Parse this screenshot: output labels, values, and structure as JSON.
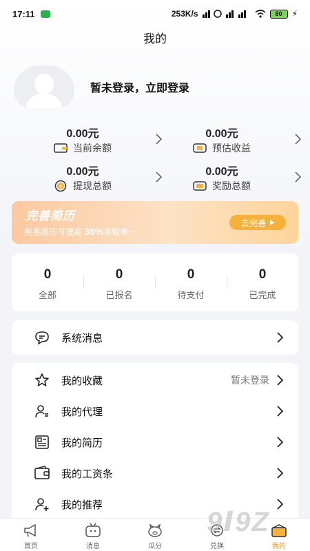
{
  "status_bar": {
    "time": "17:11",
    "speed": "253K/s",
    "battery": "80"
  },
  "header": {
    "title": "我的"
  },
  "profile": {
    "login_text": "暂未登录，立即登录"
  },
  "stats": [
    {
      "value": "0.00元",
      "label": "当前余额",
      "icon": "wallet-icon"
    },
    {
      "value": "0.00元",
      "label": "预估收益",
      "icon": "income-box-icon"
    },
    {
      "value": "0.00元",
      "label": "提现总额",
      "icon": "yen-coin-icon"
    },
    {
      "value": "0.00元",
      "label": "奖励总额",
      "icon": "reward-box-icon"
    }
  ],
  "banner": {
    "title": "完善简历",
    "subtitle_prefix": "完善简历可提高",
    "subtitle_pct": "38%",
    "subtitle_suffix": "录取率~",
    "button_label": "去完善"
  },
  "orders": [
    {
      "count": "0",
      "label": "全部"
    },
    {
      "count": "0",
      "label": "已报名"
    },
    {
      "count": "0",
      "label": "待支付"
    },
    {
      "count": "0",
      "label": "已完成"
    }
  ],
  "system_message": {
    "label": "系统消息"
  },
  "menu": [
    {
      "label": "我的收藏",
      "hint": "暂未登录",
      "icon": "star-icon"
    },
    {
      "label": "我的代理",
      "hint": "",
      "icon": "agent-user-icon"
    },
    {
      "label": "我的简历",
      "hint": "",
      "icon": "resume-icon"
    },
    {
      "label": "我的工资条",
      "hint": "",
      "icon": "payslip-icon"
    },
    {
      "label": "我的推荐",
      "hint": "",
      "icon": "add-user-icon"
    }
  ],
  "tabbar": [
    {
      "label": "首页",
      "icon": "megaphone-icon"
    },
    {
      "label": "消息",
      "icon": "tv-message-icon"
    },
    {
      "label": "瓜分",
      "icon": "pig-icon"
    },
    {
      "label": "兑换",
      "icon": "exchange-icon"
    },
    {
      "label": "我的",
      "icon": "mine-icon",
      "active": true
    }
  ],
  "colors": {
    "accent": "#f6b13c",
    "banner_start": "#fbc9a0",
    "banner_end": "#fdd49b"
  }
}
